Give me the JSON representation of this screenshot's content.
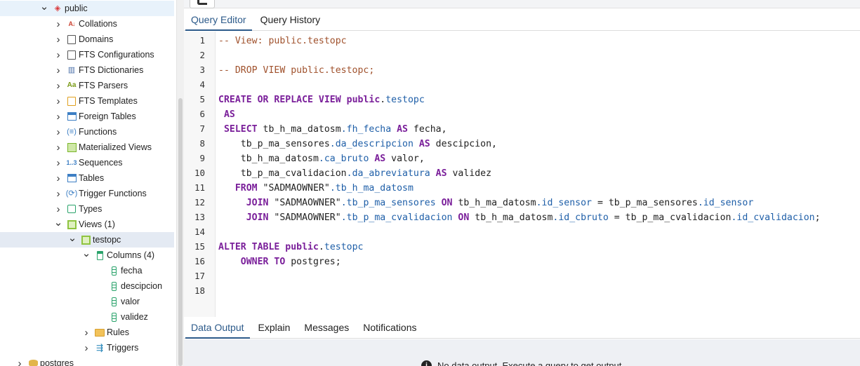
{
  "sidebar": {
    "items": [
      {
        "label": "public",
        "icon": "schema-icon",
        "state": "open",
        "indent": 0,
        "style": "hilite"
      },
      {
        "label": "Collations",
        "icon": "collation-icon",
        "state": "closed",
        "indent": 1
      },
      {
        "label": "Domains",
        "icon": "domain-icon",
        "state": "closed",
        "indent": 1
      },
      {
        "label": "FTS Configurations",
        "icon": "fts-config-icon",
        "state": "closed",
        "indent": 1
      },
      {
        "label": "FTS Dictionaries",
        "icon": "fts-dictionary-icon",
        "state": "closed",
        "indent": 1
      },
      {
        "label": "FTS Parsers",
        "icon": "fts-parser-icon",
        "state": "closed",
        "indent": 1
      },
      {
        "label": "FTS Templates",
        "icon": "fts-template-icon",
        "state": "closed",
        "indent": 1
      },
      {
        "label": "Foreign Tables",
        "icon": "foreign-table-icon",
        "state": "closed",
        "indent": 1
      },
      {
        "label": "Functions",
        "icon": "function-icon",
        "state": "closed",
        "indent": 1
      },
      {
        "label": "Materialized Views",
        "icon": "materialized-view-icon",
        "state": "closed",
        "indent": 1
      },
      {
        "label": "Sequences",
        "icon": "sequence-icon",
        "state": "closed",
        "indent": 1
      },
      {
        "label": "Tables",
        "icon": "table-icon",
        "state": "closed",
        "indent": 1
      },
      {
        "label": "Trigger Functions",
        "icon": "trigger-function-icon",
        "state": "closed",
        "indent": 1
      },
      {
        "label": "Types",
        "icon": "type-icon",
        "state": "closed",
        "indent": 1
      },
      {
        "label": "Views (1)",
        "icon": "view-icon",
        "state": "open",
        "indent": 1
      },
      {
        "label": "testopc",
        "icon": "view-icon",
        "state": "open",
        "indent": 2,
        "style": "selected"
      },
      {
        "label": "Columns (4)",
        "icon": "columns-icon",
        "state": "open",
        "indent": 3
      },
      {
        "label": "fecha",
        "icon": "column-icon",
        "state": "leaf",
        "indent": 4
      },
      {
        "label": "descipcion",
        "icon": "column-icon",
        "state": "leaf",
        "indent": 4
      },
      {
        "label": "valor",
        "icon": "column-icon",
        "state": "leaf",
        "indent": 4
      },
      {
        "label": "validez",
        "icon": "column-icon",
        "state": "leaf",
        "indent": 4
      },
      {
        "label": "Rules",
        "icon": "rules-icon",
        "state": "closed",
        "indent": 3
      },
      {
        "label": "Triggers",
        "icon": "triggers-icon",
        "state": "closed",
        "indent": 3
      },
      {
        "label": "postgres",
        "icon": "database-icon",
        "state": "closed",
        "indent": -1
      }
    ]
  },
  "editor_tabs": [
    {
      "label": "Query Editor",
      "active": true
    },
    {
      "label": "Query History",
      "active": false
    }
  ],
  "editor": {
    "line_numbers": [
      "1",
      "2",
      "3",
      "4",
      "5",
      "6",
      "7",
      "8",
      "9",
      "10",
      "11",
      "12",
      "13",
      "14",
      "15",
      "16",
      "17",
      "18"
    ],
    "lines": [
      [
        {
          "t": "-- View: public.testopc",
          "c": "cm"
        }
      ],
      [],
      [
        {
          "t": "-- DROP VIEW public.testopc;",
          "c": "cm"
        }
      ],
      [],
      [
        {
          "t": "CREATE OR REPLACE VIEW ",
          "c": "kw"
        },
        {
          "t": "public",
          "c": "kw"
        },
        {
          "t": ".",
          "c": "st"
        },
        {
          "t": "testopc",
          "c": "pr"
        }
      ],
      [
        {
          "t": " AS",
          "c": "kw"
        }
      ],
      [
        {
          "t": " SELECT ",
          "c": "kw"
        },
        {
          "t": "tb_h_ma_datosm",
          "c": "st"
        },
        {
          "t": ".fh_fecha",
          "c": "pr"
        },
        {
          "t": " AS ",
          "c": "kw"
        },
        {
          "t": "fecha,",
          "c": "st"
        }
      ],
      [
        {
          "t": "    tb_p_ma_sensores",
          "c": "st"
        },
        {
          "t": ".da_descripcion",
          "c": "pr"
        },
        {
          "t": " AS ",
          "c": "kw"
        },
        {
          "t": "descipcion,",
          "c": "st"
        }
      ],
      [
        {
          "t": "    tb_h_ma_datosm",
          "c": "st"
        },
        {
          "t": ".ca_bruto",
          "c": "pr"
        },
        {
          "t": " AS ",
          "c": "kw"
        },
        {
          "t": "valor,",
          "c": "st"
        }
      ],
      [
        {
          "t": "    tb_p_ma_cvalidacion",
          "c": "st"
        },
        {
          "t": ".da_abreviatura",
          "c": "pr"
        },
        {
          "t": " AS ",
          "c": "kw"
        },
        {
          "t": "validez",
          "c": "st"
        }
      ],
      [
        {
          "t": "   FROM ",
          "c": "kw"
        },
        {
          "t": "\"SADMAOWNER\"",
          "c": "st"
        },
        {
          "t": ".tb_h_ma_datosm",
          "c": "pr"
        }
      ],
      [
        {
          "t": "     JOIN ",
          "c": "kw"
        },
        {
          "t": "\"SADMAOWNER\"",
          "c": "st"
        },
        {
          "t": ".tb_p_ma_sensores",
          "c": "pr"
        },
        {
          "t": " ON ",
          "c": "kw"
        },
        {
          "t": "tb_h_ma_datosm",
          "c": "st"
        },
        {
          "t": ".id_sensor",
          "c": "pr"
        },
        {
          "t": " = tb_p_ma_sensores",
          "c": "st"
        },
        {
          "t": ".id_sensor",
          "c": "pr"
        }
      ],
      [
        {
          "t": "     JOIN ",
          "c": "kw"
        },
        {
          "t": "\"SADMAOWNER\"",
          "c": "st"
        },
        {
          "t": ".tb_p_ma_cvalidacion",
          "c": "pr"
        },
        {
          "t": " ON ",
          "c": "kw"
        },
        {
          "t": "tb_h_ma_datosm",
          "c": "st"
        },
        {
          "t": ".id_cbruto",
          "c": "pr"
        },
        {
          "t": " = tb_p_ma_cvalidacion",
          "c": "st"
        },
        {
          "t": ".id_cvalidacion",
          "c": "pr"
        },
        {
          "t": ";",
          "c": "st"
        }
      ],
      [],
      [
        {
          "t": "ALTER TABLE ",
          "c": "kw"
        },
        {
          "t": "public",
          "c": "kw"
        },
        {
          "t": ".",
          "c": "st"
        },
        {
          "t": "testopc",
          "c": "pr"
        }
      ],
      [
        {
          "t": "    OWNER TO ",
          "c": "kw"
        },
        {
          "t": "postgres;",
          "c": "st"
        }
      ],
      [],
      []
    ]
  },
  "output_tabs": [
    {
      "label": "Data Output",
      "active": true
    },
    {
      "label": "Explain",
      "active": false
    },
    {
      "label": "Messages",
      "active": false
    },
    {
      "label": "Notifications",
      "active": false
    }
  ],
  "output": {
    "message": "No data output. Execute a query to get output."
  }
}
